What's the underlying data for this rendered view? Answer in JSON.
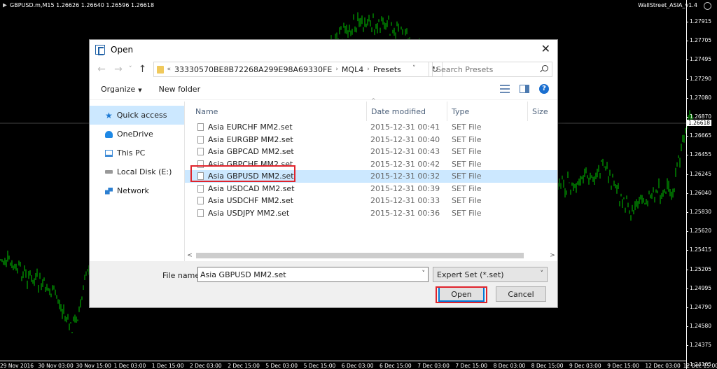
{
  "chart": {
    "header_left": "GBPUSD.m,M15  1.26626 1.26640 1.26596 1.26618",
    "header_right": "WallStreet_ASIA_v1.4",
    "price_levels": [
      "1.27915",
      "1.27705",
      "1.27495",
      "1.27290",
      "1.27080",
      "1.26870",
      "1.26665",
      "1.26455",
      "1.26245",
      "1.26040",
      "1.25830",
      "1.25620",
      "1.25415",
      "1.25205",
      "1.24995",
      "1.24790",
      "1.24580",
      "1.24375",
      "1.24165"
    ],
    "current_price": "1.26618",
    "time_labels": [
      "29 Nov 2016",
      "30 Nov 03:00",
      "30 Nov 15:00",
      "1 Dec 03:00",
      "1 Dec 15:00",
      "2 Dec 03:00",
      "2 Dec 15:00",
      "5 Dec 03:00",
      "5 Dec 15:00",
      "6 Dec 03:00",
      "6 Dec 15:00",
      "7 Dec 03:00",
      "7 Dec 15:00",
      "8 Dec 03:00",
      "8 Dec 15:00",
      "9 Dec 03:00",
      "9 Dec 15:00",
      "12 Dec 03:00",
      "12 Dec 15:00"
    ],
    "colors": {
      "candle": "#00c800",
      "background": "#000000",
      "axis": "#ffffff"
    }
  },
  "dialog": {
    "title": "Open",
    "close_glyph": "✕",
    "nav_back": "←",
    "nav_forward": "→",
    "nav_chevron": "˅",
    "nav_up": "↑",
    "address": {
      "overflow": "«",
      "crumbs": [
        "33330570BE8B72268A299E98A69330FE",
        "MQL4",
        "Presets"
      ],
      "sep": "›",
      "drop": "˅",
      "refresh": "↻"
    },
    "search_placeholder": "Search Presets",
    "toolbar": {
      "organize": "Organize",
      "organize_caret": "▼",
      "new_folder": "New folder",
      "help": "?"
    },
    "nav_items": [
      {
        "label": "Quick access",
        "icon": "star-icon",
        "icon_glyph": "★"
      },
      {
        "label": "OneDrive",
        "icon": "cloud-icon"
      },
      {
        "label": "This PC",
        "icon": "computer-icon"
      },
      {
        "label": "Local Disk (E:)",
        "icon": "disk-icon"
      },
      {
        "label": "Network",
        "icon": "network-icon"
      }
    ],
    "columns": {
      "sort_caret": "^",
      "name": "Name",
      "date": "Date modified",
      "type": "Type",
      "size": "Size"
    },
    "files": [
      {
        "name": "Asia EURCHF MM2.set",
        "date": "2015-12-31 00:41",
        "type": "SET File"
      },
      {
        "name": "Asia EURGBP MM2.set",
        "date": "2015-12-31 00:40",
        "type": "SET File"
      },
      {
        "name": "Asia GBPCAD MM2.set",
        "date": "2015-12-31 00:43",
        "type": "SET File"
      },
      {
        "name": "Asia GBPCHF MM2.set",
        "date": "2015-12-31 00:42",
        "type": "SET File"
      },
      {
        "name": "Asia GBPUSD MM2.set",
        "date": "2015-12-31 00:32",
        "type": "SET File"
      },
      {
        "name": "Asia USDCAD MM2.set",
        "date": "2015-12-31 00:39",
        "type": "SET File"
      },
      {
        "name": "Asia USDCHF MM2.set",
        "date": "2015-12-31 00:33",
        "type": "SET File"
      },
      {
        "name": "Asia USDJPY MM2.set",
        "date": "2015-12-31 00:36",
        "type": "SET File"
      }
    ],
    "selected_index": 4,
    "scroll": {
      "left": "<",
      "right": ">"
    },
    "file_name_label": "File name:",
    "file_name_value": "Asia GBPUSD MM2.set",
    "file_type_value": "Expert Set (*.set)",
    "select_drop": "˅",
    "open_label": "Open",
    "cancel_label": "Cancel",
    "highlight_color": "#e0242c"
  }
}
